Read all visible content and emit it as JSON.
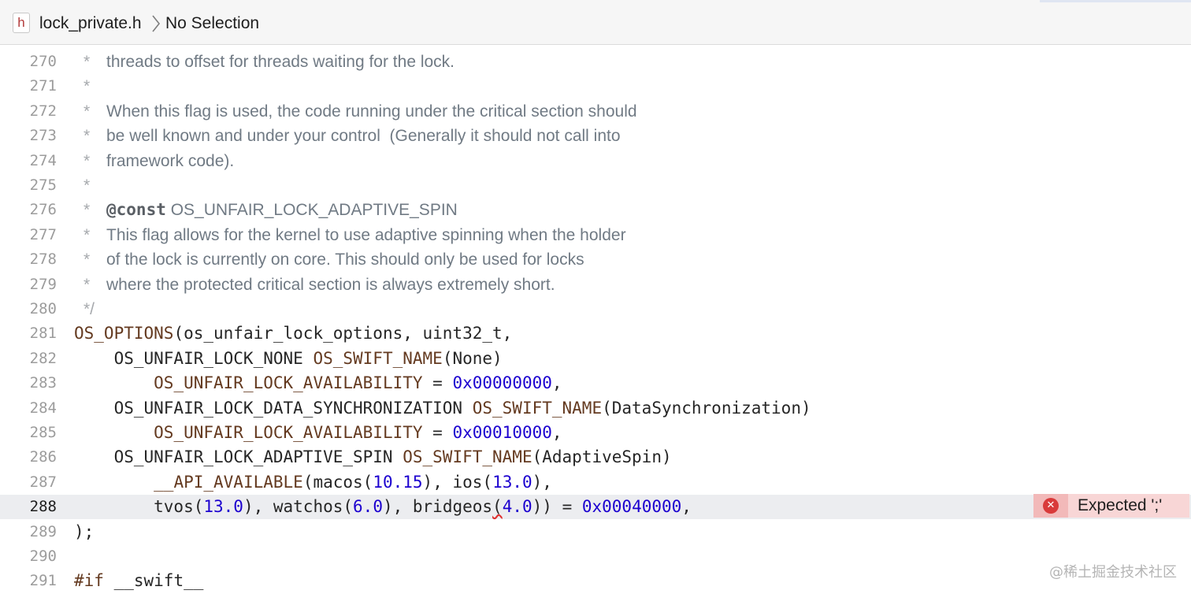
{
  "jumpbar": {
    "file_icon": "h",
    "file_name": "lock_private.h",
    "separator_icon": "chevron-right-icon",
    "selection": "No Selection"
  },
  "error": {
    "icon": "error-circle-icon",
    "message": "Expected ';'"
  },
  "watermark": "@稀土掘金技术社区",
  "lines": [
    {
      "n": "270",
      "kind": "comment",
      "star": "*",
      "text": "threads to offset for threads waiting for the lock."
    },
    {
      "n": "271",
      "kind": "comment",
      "star": "*",
      "text": ""
    },
    {
      "n": "272",
      "kind": "comment",
      "star": "*",
      "text": "When this flag is used, the code running under the critical section should"
    },
    {
      "n": "273",
      "kind": "comment",
      "star": "*",
      "text": "be well known and under your control  (Generally it should not call into"
    },
    {
      "n": "274",
      "kind": "comment",
      "star": "*",
      "text": "framework code)."
    },
    {
      "n": "275",
      "kind": "comment",
      "star": "*",
      "text": ""
    },
    {
      "n": "276",
      "kind": "comment",
      "star": "*",
      "tag": "@const",
      "text": " OS_UNFAIR_LOCK_ADAPTIVE_SPIN"
    },
    {
      "n": "277",
      "kind": "comment",
      "star": "*",
      "text": "This flag allows for the kernel to use adaptive spinning when the holder"
    },
    {
      "n": "278",
      "kind": "comment",
      "star": "*",
      "text": "of the lock is currently on core. This should only be used for locks"
    },
    {
      "n": "279",
      "kind": "comment",
      "star": "*",
      "text": "where the protected critical section is always extremely short."
    },
    {
      "n": "280",
      "kind": "comment",
      "star": "*/",
      "text": ""
    },
    {
      "n": "281",
      "kind": "code",
      "tokens": [
        {
          "t": "OS_OPTIONS",
          "c": "macro"
        },
        {
          "t": "(os_unfair_lock_options, uint32_t,"
        }
      ]
    },
    {
      "n": "282",
      "kind": "code",
      "tokens": [
        {
          "t": "    OS_UNFAIR_LOCK_NONE "
        },
        {
          "t": "OS_SWIFT_NAME",
          "c": "macro"
        },
        {
          "t": "(None)"
        }
      ]
    },
    {
      "n": "283",
      "kind": "code",
      "tokens": [
        {
          "t": "        "
        },
        {
          "t": "OS_UNFAIR_LOCK_AVAILABILITY",
          "c": "macro"
        },
        {
          "t": " = "
        },
        {
          "t": "0x00000000",
          "c": "num"
        },
        {
          "t": ","
        }
      ]
    },
    {
      "n": "284",
      "kind": "code",
      "tokens": [
        {
          "t": "    OS_UNFAIR_LOCK_DATA_SYNCHRONIZATION "
        },
        {
          "t": "OS_SWIFT_NAME",
          "c": "macro"
        },
        {
          "t": "(DataSynchronization)"
        }
      ]
    },
    {
      "n": "285",
      "kind": "code",
      "tokens": [
        {
          "t": "        "
        },
        {
          "t": "OS_UNFAIR_LOCK_AVAILABILITY",
          "c": "macro"
        },
        {
          "t": " = "
        },
        {
          "t": "0x00010000",
          "c": "num"
        },
        {
          "t": ","
        }
      ]
    },
    {
      "n": "286",
      "kind": "code",
      "tokens": [
        {
          "t": "    OS_UNFAIR_LOCK_ADAPTIVE_SPIN "
        },
        {
          "t": "OS_SWIFT_NAME",
          "c": "macro"
        },
        {
          "t": "(AdaptiveSpin)"
        }
      ]
    },
    {
      "n": "287",
      "kind": "code",
      "tokens": [
        {
          "t": "        "
        },
        {
          "t": "__API_AVAILABLE",
          "c": "macro"
        },
        {
          "t": "(macos("
        },
        {
          "t": "10.15",
          "c": "num"
        },
        {
          "t": "), ios("
        },
        {
          "t": "13.0",
          "c": "num"
        },
        {
          "t": "),"
        }
      ]
    },
    {
      "n": "288",
      "kind": "code",
      "current": true,
      "tokens": [
        {
          "t": "        tvos("
        },
        {
          "t": "13.0",
          "c": "num"
        },
        {
          "t": "), watchos("
        },
        {
          "t": "6.0",
          "c": "num"
        },
        {
          "t": "), bridgeos"
        },
        {
          "t": "(",
          "c": "squiggle"
        },
        {
          "t": "4.0",
          "c": "num"
        },
        {
          "t": ")) = "
        },
        {
          "t": "0x00040000",
          "c": "num"
        },
        {
          "t": ","
        }
      ]
    },
    {
      "n": "289",
      "kind": "code",
      "tokens": [
        {
          "t": ");"
        }
      ]
    },
    {
      "n": "290",
      "kind": "code",
      "tokens": [
        {
          "t": ""
        }
      ]
    },
    {
      "n": "291",
      "kind": "code",
      "tokens": [
        {
          "t": "#if",
          "c": "macro"
        },
        {
          "t": " __swift__"
        }
      ]
    }
  ]
}
